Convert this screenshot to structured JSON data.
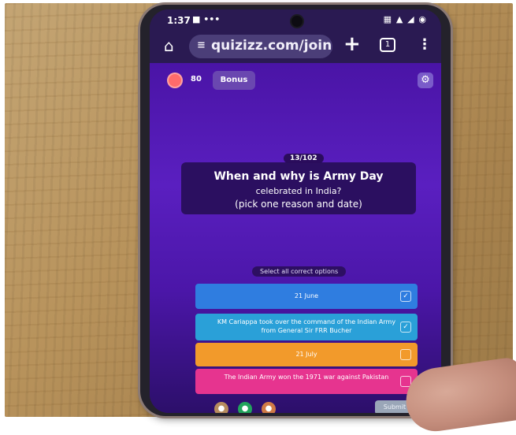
{
  "status_bar": {
    "time": "1:37",
    "notifications": "■ •••",
    "icons": "▦ ▲ ◢ ◉"
  },
  "browser": {
    "url": "quizizz.com/join/g",
    "tabs_count": "1"
  },
  "quiz": {
    "powerup_count": "80",
    "bonus_label": "Bonus",
    "question_counter": "13/102",
    "question_line1": "When and why is Army Day",
    "question_line2": "celebrated in India?",
    "question_line3": "(pick one reason and date)",
    "instruction": "Select all correct options",
    "options": [
      {
        "label": "21 June",
        "color": "#2f7de0"
      },
      {
        "label": "KM Cariappa took over the command of the Indian Army from General Sir FRR Bucher",
        "color": "#2aa0d8"
      },
      {
        "label": "21 July",
        "color": "#f29a2b"
      },
      {
        "label": "The Indian Army won the 1971 war against Pakistan",
        "color": "#e6348f"
      }
    ],
    "submit_label": "Submit"
  },
  "icons": {
    "home": "home-icon",
    "settings": "settings-icon",
    "powerups": [
      "powerup-icon",
      "powerup-icon",
      "powerup-icon"
    ]
  }
}
